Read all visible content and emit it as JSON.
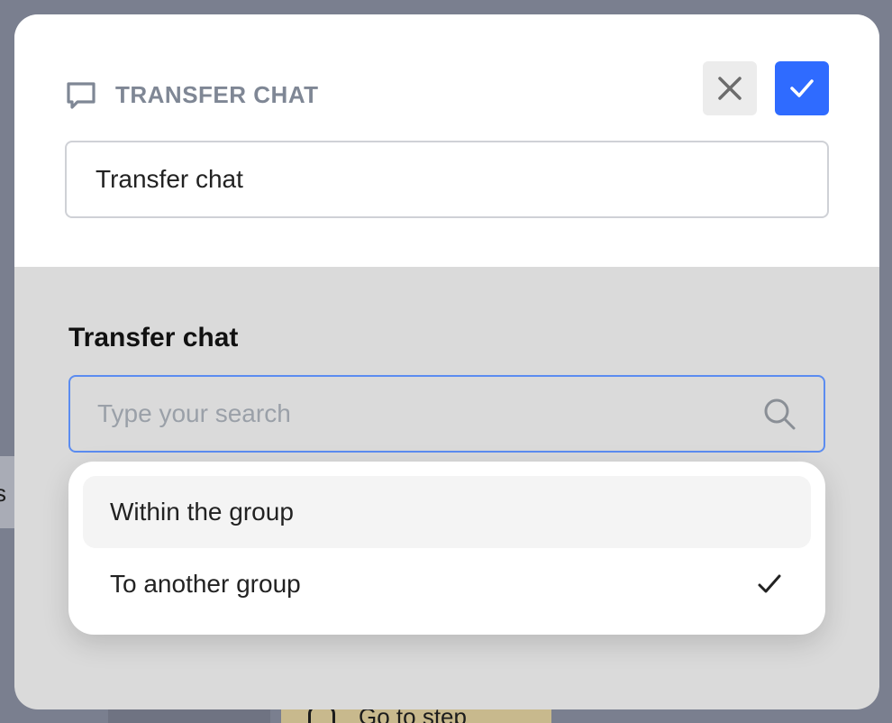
{
  "background": {
    "left_tab_glyph": "s",
    "goto_step_label": "Go to step"
  },
  "modal": {
    "title": "TRANSFER CHAT",
    "title_icon": "chat-bubble-icon",
    "close_icon": "close-icon",
    "confirm_icon": "checkmark-icon",
    "name_value": "Transfer chat",
    "section_label": "Transfer chat",
    "search": {
      "placeholder": "Type your search",
      "icon": "search-icon"
    },
    "options": [
      {
        "label": "Within the group",
        "selected": false,
        "highlighted": true
      },
      {
        "label": "To another group",
        "selected": true,
        "highlighted": false
      }
    ]
  },
  "colors": {
    "accent": "#2f6bff",
    "overlay": "#7a7f8f",
    "modal_lower": "#dadada",
    "title_gray": "#7f8795",
    "focus_border": "#5b8cf0"
  }
}
